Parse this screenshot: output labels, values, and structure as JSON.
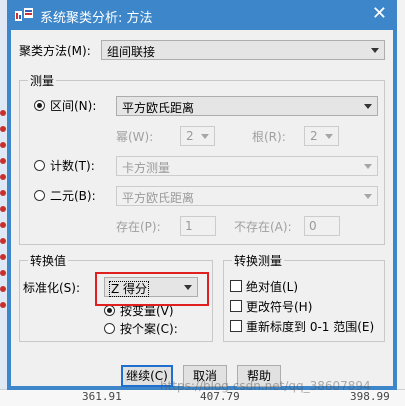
{
  "window": {
    "title": "系统聚类分析: 方法",
    "close_glyph": "✕"
  },
  "cluster_method": {
    "label": "聚类方法(M):",
    "value": "组间联接"
  },
  "measure": {
    "title": "测量",
    "interval": {
      "label": "区间(N):",
      "value": "平方欧氏距离",
      "selected": true
    },
    "power": {
      "label": "幂(W):",
      "value": "2"
    },
    "root": {
      "label": "根(R):",
      "value": "2"
    },
    "count": {
      "label": "计数(T):",
      "value": "卡方测量",
      "selected": false
    },
    "binary": {
      "label": "二元(B):",
      "value": "平方欧氏距离",
      "selected": false
    },
    "present": {
      "label": "存在(P):",
      "value": "1"
    },
    "absent": {
      "label": "不存在(A):",
      "value": "0"
    }
  },
  "transform_values": {
    "title": "转换值",
    "standardize_label": "标准化(S):",
    "standardize_value": "Z 得分",
    "by_variable": {
      "label": "按变量(V)",
      "selected": true
    },
    "by_case": {
      "label": "按个案(C):",
      "selected": false
    }
  },
  "transform_measures": {
    "title": "转换测量",
    "absolute": {
      "label": "绝对值(L)",
      "checked": false
    },
    "change_sign": {
      "label": "更改符号(H)",
      "checked": false
    },
    "rescale": {
      "label": "重新标度到 0-1 范围(E)",
      "checked": false
    }
  },
  "buttons": {
    "continue": "继续(C)",
    "cancel": "取消",
    "help": "帮助"
  },
  "background": {
    "values": [
      "361.91",
      "407.79",
      "398.99"
    ]
  },
  "watermark": "https://blog.csdn.net/qq_38607894",
  "colors": {
    "titlebar": "#3c86c9",
    "highlight_box": "#e02020",
    "default_button_border": "#1f6fd1"
  }
}
